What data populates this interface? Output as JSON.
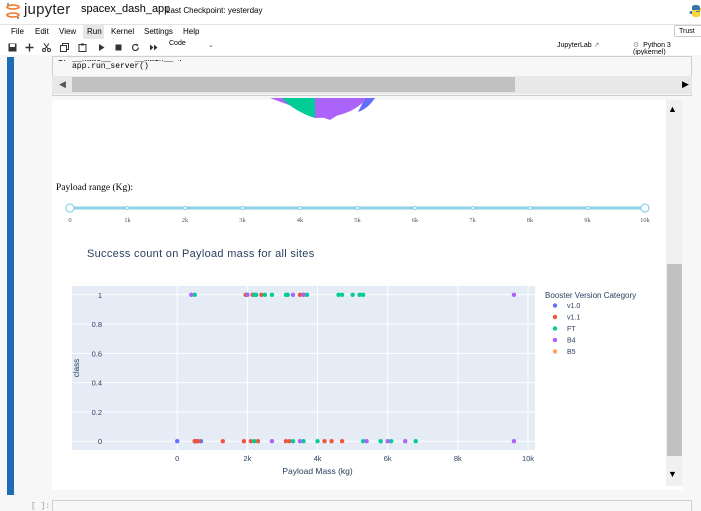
{
  "header": {
    "brand": "jupyter",
    "notebook_name": "spacex_dash_app",
    "checkpoint": "Last Checkpoint: yesterday",
    "trust_label": "Trust"
  },
  "menu": [
    "File",
    "Edit",
    "View",
    "Run",
    "Kernel",
    "Settings",
    "Help"
  ],
  "toolbar": {
    "icons": [
      "save-icon",
      "add-icon",
      "cut-icon",
      "copy-icon",
      "paste-icon",
      "run-icon",
      "stop-icon",
      "restart-icon",
      "fast-forward-icon"
    ],
    "cell_type": "Code",
    "jupyterlab_link": "JupyterLab",
    "kernel": "Python 3 (ipykernel)"
  },
  "code": {
    "line0": "if __name__ == '__main__':",
    "line1": "app.run_server()"
  },
  "slider": {
    "label": "Payload range (Kg):",
    "ticks": [
      "0",
      "1k",
      "2k",
      "3k",
      "4k",
      "5k",
      "6k",
      "7k",
      "8k",
      "9k",
      "10k"
    ],
    "min": 0,
    "max": 10000,
    "value": [
      0,
      10000
    ]
  },
  "prompt": "[ ]:",
  "chart_data": {
    "type": "scatter",
    "title": "Success count on Payload mass for all sites",
    "xlabel": "Payload Mass (kg)",
    "ylabel": "class",
    "xlim": [
      -3000,
      10200
    ],
    "ylim": [
      -0.06,
      1.06
    ],
    "x_ticks": [
      "0",
      "2k",
      "4k",
      "6k",
      "8k",
      "10k"
    ],
    "x_tick_values": [
      0,
      2000,
      4000,
      6000,
      8000,
      10000
    ],
    "y_ticks": [
      "0",
      "0.2",
      "0.4",
      "0.6",
      "0.8",
      "1"
    ],
    "y_tick_values": [
      0,
      0.2,
      0.4,
      0.6,
      0.8,
      1
    ],
    "legend_title": "Booster Version Category",
    "legend_position": "right",
    "series": [
      {
        "name": "v1.0",
        "color": "#636efa",
        "points": [
          [
            0,
            0
          ],
          [
            525,
            0
          ],
          [
            677,
            0
          ],
          [
            500,
            0
          ]
        ]
      },
      {
        "name": "v1.1",
        "color": "#ef553b",
        "points": [
          [
            500,
            0
          ],
          [
            570,
            0
          ],
          [
            600,
            0
          ],
          [
            1300,
            0
          ],
          [
            1900,
            0
          ],
          [
            2100,
            0
          ],
          [
            2300,
            0
          ],
          [
            3100,
            0
          ],
          [
            3200,
            0
          ],
          [
            4200,
            0
          ],
          [
            4400,
            0
          ],
          [
            4700,
            0
          ],
          [
            1950,
            1
          ],
          [
            2150,
            1
          ],
          [
            2400,
            1
          ],
          [
            3500,
            1
          ],
          [
            3600,
            1
          ]
        ]
      },
      {
        "name": "FT",
        "color": "#00cc96",
        "points": [
          [
            2200,
            0
          ],
          [
            3300,
            0
          ],
          [
            3600,
            0
          ],
          [
            4000,
            0
          ],
          [
            5300,
            0
          ],
          [
            5800,
            0
          ],
          [
            6100,
            0
          ],
          [
            6800,
            0
          ],
          [
            2000,
            1
          ],
          [
            2200,
            1
          ],
          [
            2250,
            1
          ],
          [
            2500,
            1
          ],
          [
            2700,
            1
          ],
          [
            3100,
            1
          ],
          [
            3150,
            1
          ],
          [
            3700,
            1
          ],
          [
            4600,
            1
          ],
          [
            4700,
            1
          ],
          [
            5000,
            1
          ],
          [
            5200,
            1
          ],
          [
            5300,
            1
          ],
          [
            500,
            1
          ]
        ]
      },
      {
        "name": "B4",
        "color": "#ab63fa",
        "points": [
          [
            2700,
            0
          ],
          [
            3500,
            0
          ],
          [
            5400,
            0
          ],
          [
            6000,
            0
          ],
          [
            6500,
            0
          ],
          [
            9600,
            0
          ],
          [
            9600,
            1
          ],
          [
            400,
            1
          ],
          [
            3300,
            1
          ],
          [
            3600,
            1
          ],
          [
            2000,
            1
          ]
        ]
      },
      {
        "name": "B5",
        "color": "#ffa15a",
        "points": []
      }
    ]
  }
}
